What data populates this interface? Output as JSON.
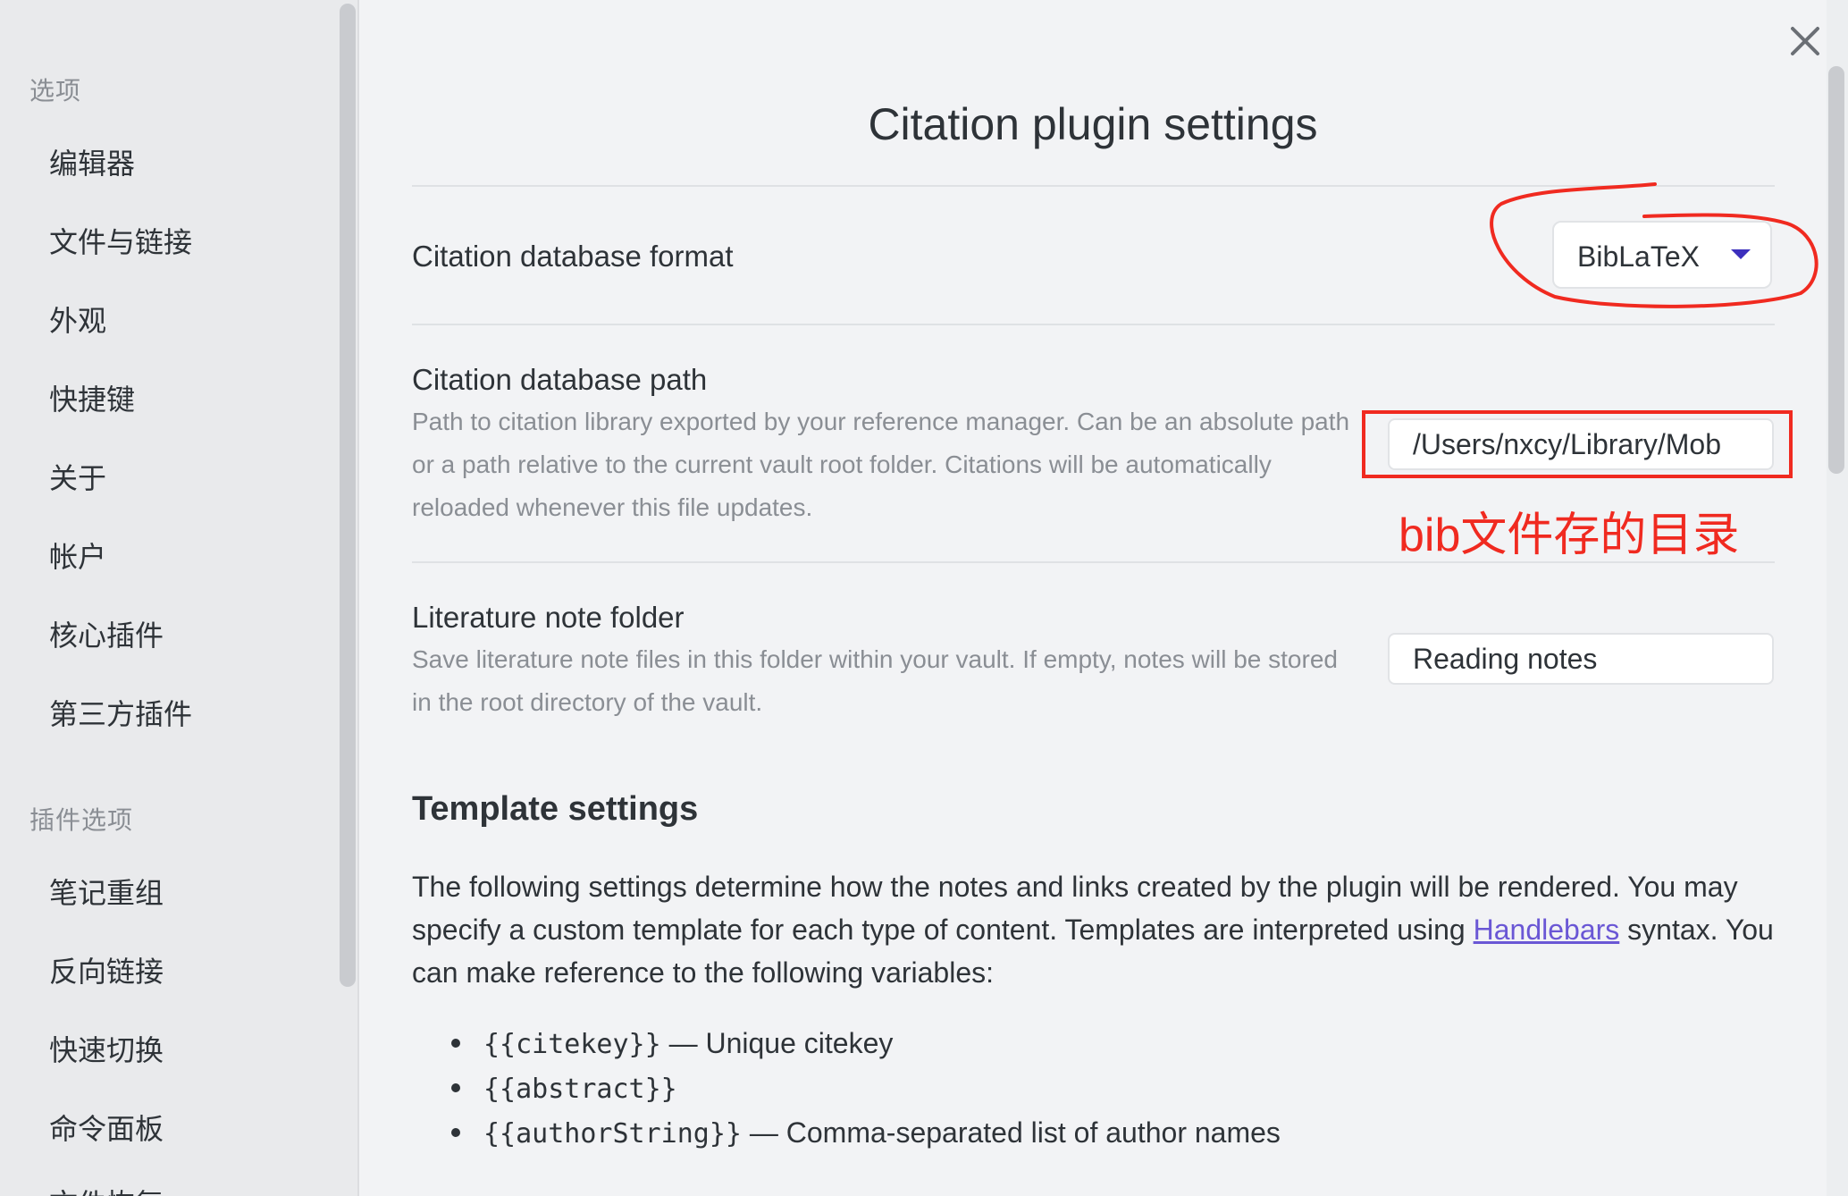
{
  "sidebar": {
    "options_heading": "选项",
    "options_items": [
      {
        "label": "编辑器"
      },
      {
        "label": "文件与链接"
      },
      {
        "label": "外观"
      },
      {
        "label": "快捷键"
      },
      {
        "label": "关于"
      },
      {
        "label": "帐户"
      },
      {
        "label": "核心插件"
      },
      {
        "label": "第三方插件"
      }
    ],
    "plugin_heading": "插件选项",
    "plugin_items": [
      {
        "label": "笔记重组"
      },
      {
        "label": "反向链接"
      },
      {
        "label": "快速切换"
      },
      {
        "label": "命令面板"
      },
      {
        "label": "文件恢复"
      }
    ]
  },
  "main": {
    "title": "Citation plugin settings",
    "close_icon": "close-icon",
    "settings": {
      "format": {
        "name": "Citation database format",
        "selected": "BibLaTeX"
      },
      "path": {
        "name": "Citation database path",
        "description": "Path to citation library exported by your reference manager. Can be an absolute path or a path relative to the current vault root folder. Citations will be automatically reloaded whenever this file updates.",
        "value": "/Users/nxcy/Library/Mob"
      },
      "folder": {
        "name": "Literature note folder",
        "description": "Save literature note files in this folder within your vault. If empty, notes will be stored in the root directory of the vault.",
        "value": "Reading notes"
      }
    },
    "annotation": {
      "text": "bib文件存的目录",
      "color": "#f02a20"
    },
    "template": {
      "heading": "Template settings",
      "paragraph_before_link": "The following settings determine how the notes and links created by the plugin will be rendered. You may specify a custom template for each type of content. Templates are interpreted using ",
      "link_text": "Handlebars",
      "paragraph_after_link": " syntax. You can make reference to the following variables:",
      "variables": [
        {
          "code": "{{citekey}}",
          "desc": " — Unique citekey"
        },
        {
          "code": "{{abstract}}",
          "desc": ""
        },
        {
          "code": "{{authorString}}",
          "desc": " — Comma-separated list of author names"
        }
      ]
    }
  },
  "colors": {
    "accent": "#6a57d5",
    "caret": "#3c2fbd",
    "annotation": "#f02a20"
  }
}
